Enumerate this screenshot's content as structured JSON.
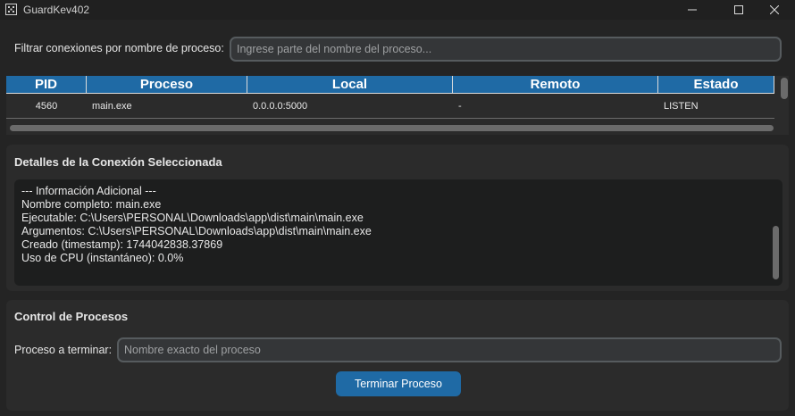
{
  "window": {
    "title": "GuardKev402",
    "icon": "app-grid-icon"
  },
  "filter": {
    "label": "Filtrar conexiones por nombre de proceso:",
    "value": "",
    "placeholder": "Ingrese parte del nombre del proceso..."
  },
  "table": {
    "headers": [
      "PID",
      "Proceso",
      "Local",
      "Remoto",
      "Estado"
    ],
    "rows": [
      [
        "4560",
        "main.exe",
        "0.0.0.0:5000",
        "-",
        "LISTEN"
      ]
    ]
  },
  "details": {
    "title": "Detalles de la Conexión Seleccionada",
    "lines": [
      "--- Información Adicional ---",
      "Nombre completo: main.exe",
      "Ejecutable: C:\\Users\\PERSONAL\\Downloads\\app\\dist\\main\\main.exe",
      "Argumentos: C:\\Users\\PERSONAL\\Downloads\\app\\dist\\main\\main.exe",
      "Creado (timestamp): 1744042838.37869",
      "Uso de CPU (instantáneo): 0.0%"
    ]
  },
  "control": {
    "title": "Control de Procesos",
    "label": "Proceso a terminar:",
    "value": "",
    "placeholder": "Nombre exacto del proceso",
    "button_label": "Terminar Proceso"
  },
  "colors": {
    "accent": "#1f6aa5",
    "background": "#242424",
    "frame": "#2b2b2b",
    "textbox": "#1d1e1e"
  }
}
